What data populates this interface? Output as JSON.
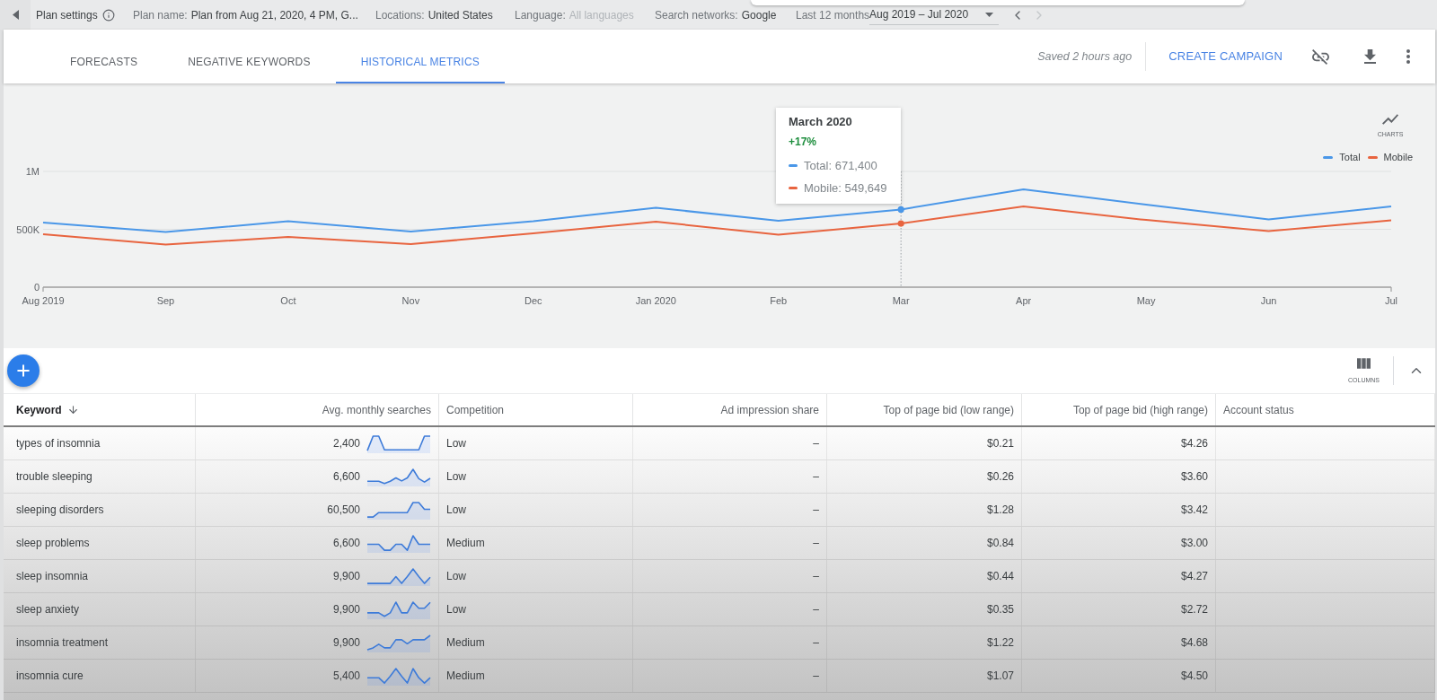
{
  "top_bar": {
    "plan_settings": "Plan settings",
    "fields": [
      {
        "label": "Plan name:",
        "value": "Plan from Aug 21, 2020, 4 PM, G...",
        "dimmed": false
      },
      {
        "label": "Locations:",
        "value": "United States",
        "dimmed": false
      },
      {
        "label": "Language:",
        "value": "All languages",
        "dimmed": true
      },
      {
        "label": "Search networks:",
        "value": "Google",
        "dimmed": false
      }
    ],
    "date_range": {
      "label": "Last 12 months",
      "value": "Aug 2019 – Jul 2020"
    },
    "nav": [
      {
        "kind": "prev",
        "disabled": false
      },
      {
        "kind": "next",
        "disabled": true
      }
    ]
  },
  "tabs": [
    {
      "label": "FORECASTS",
      "selected": false
    },
    {
      "label": "NEGATIVE KEYWORDS",
      "selected": false
    },
    {
      "label": "HISTORICAL METRICS",
      "selected": true
    }
  ],
  "header_actions": {
    "saved_status": "Saved 2 hours ago",
    "create_campaign": "CREATE CAMPAIGN"
  },
  "chart": {
    "charts_button": "CHARTS",
    "tooltip": {
      "title": "March 2020",
      "change": "+17%",
      "rows": [
        {
          "text": "Total: 671,400",
          "color": "#4a97e8"
        },
        {
          "text": "Mobile: 549,649",
          "color": "#e8643f"
        }
      ]
    },
    "chart_data": {
      "type": "line",
      "categories": [
        "Aug 2019",
        "Sep",
        "Oct",
        "Nov",
        "Dec",
        "Jan 2020",
        "Feb",
        "Mar",
        "Apr",
        "May",
        "Jun",
        "Jul"
      ],
      "series": [
        {
          "name": "Total",
          "color": "#4a97e8",
          "values": [
            558000,
            477000,
            570000,
            481000,
            570000,
            686000,
            574000,
            671400,
            845000,
            713000,
            585000,
            698000
          ]
        },
        {
          "name": "Mobile",
          "color": "#e8643f",
          "values": [
            457000,
            368000,
            434000,
            372000,
            465000,
            566000,
            453000,
            549649,
            698000,
            581000,
            484000,
            578000
          ]
        }
      ],
      "ylim": [
        0,
        1000000
      ],
      "yticks": [
        {
          "value": 0,
          "label": "0"
        },
        {
          "value": 500000,
          "label": "500K"
        },
        {
          "value": 1000000,
          "label": "1M"
        }
      ],
      "ref_lines": [
        {
          "axis": "y",
          "value": 500000
        },
        {
          "axis": "y",
          "value": 1000000
        },
        {
          "axis": "x",
          "value": "Mar"
        }
      ],
      "legend": true
    }
  },
  "table_toolbar": {
    "columns_button": "COLUMNS"
  },
  "table": {
    "columns": [
      {
        "label": "Keyword",
        "kind": "text",
        "sorted": true
      },
      {
        "label": "Avg. monthly searches",
        "kind": "trend",
        "sorted": false
      },
      {
        "label": "Competition",
        "kind": "text",
        "sorted": false
      },
      {
        "label": "Ad impression share",
        "kind": "number",
        "sorted": false
      },
      {
        "label": "Top of page bid (low range)",
        "kind": "number",
        "sorted": false
      },
      {
        "label": "Top of page bid (high range)",
        "kind": "number",
        "sorted": false
      },
      {
        "label": "Account status",
        "kind": "text",
        "sorted": false
      }
    ],
    "rows": [
      {
        "cells": [
          "types of insomnia",
          "2,400",
          "Low",
          "–",
          "$0.21",
          "$4.26"
        ]
      },
      {
        "cells": [
          "trouble sleeping",
          "6,600",
          "Low",
          "–",
          "$0.26",
          "$3.60"
        ]
      },
      {
        "cells": [
          "sleeping disorders",
          "60,500",
          "Low",
          "–",
          "$1.28",
          "$3.42"
        ]
      },
      {
        "cells": [
          "sleep problems",
          "6,600",
          "Medium",
          "–",
          "$0.84",
          "$3.00"
        ]
      },
      {
        "cells": [
          "sleep insomnia",
          "9,900",
          "Low",
          "–",
          "$0.44",
          "$4.27"
        ]
      },
      {
        "cells": [
          "sleep anxiety",
          "9,900",
          "Low",
          "–",
          "$0.35",
          "$2.72"
        ]
      },
      {
        "cells": [
          "insomnia treatment",
          "9,900",
          "Medium",
          "–",
          "$1.22",
          "$4.68"
        ]
      },
      {
        "cells": [
          "insomnia cure",
          "5,400",
          "Medium",
          "–",
          "$1.07",
          "$4.50"
        ]
      }
    ]
  }
}
